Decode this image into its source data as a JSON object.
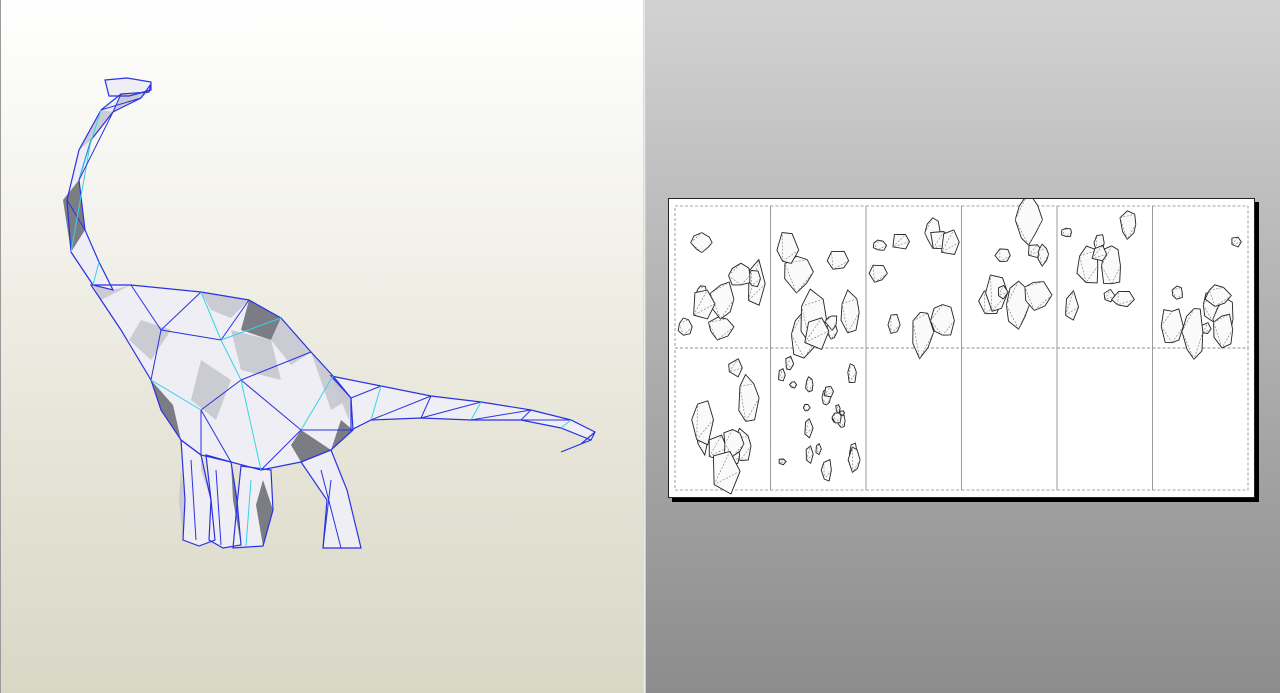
{
  "colors": {
    "mesh_edge": "#2a32e0",
    "fold_edge": "#35d4e6",
    "shade_light": "#eeeef4",
    "shade_mid": "#c6c7d0",
    "shade_dark": "#6e6f78",
    "part_line": "#222222",
    "fold_line": "#777777"
  },
  "layout_sheet": {
    "pages_columns": 6,
    "pages_rows": 2,
    "pages_with_parts": 8,
    "empty_pages": 4
  }
}
